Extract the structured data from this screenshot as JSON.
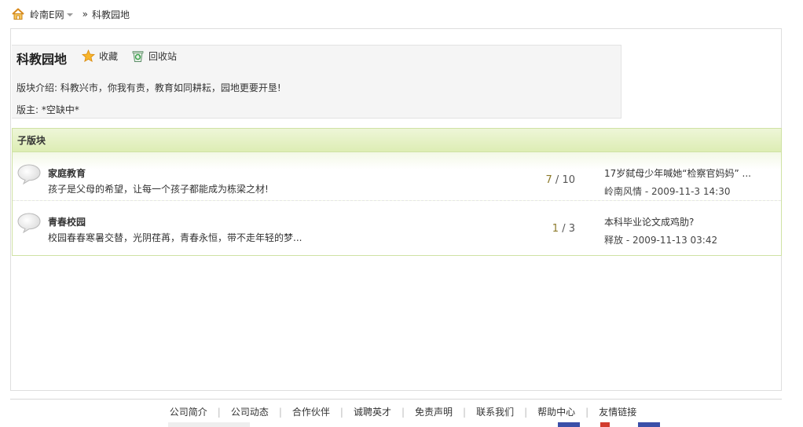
{
  "breadcrumb": {
    "site": "岭南E网",
    "separator": "»",
    "current": "科教园地"
  },
  "forum": {
    "title": "科教园地",
    "favorite_label": "收藏",
    "recycle_label": "回收站",
    "description": "版块介绍: 科教兴市，你我有责，教育如同耕耘，园地更要开垦!",
    "moderators": "版主: *空缺中*"
  },
  "subforums": {
    "header": "子版块",
    "rows": [
      {
        "name": "家庭教育",
        "description": "孩子是父母的希望，让每一个孩子都能成为栋梁之材!",
        "threads": "7",
        "slash": "/",
        "posts": "10",
        "last_title": "17岁弑母少年喊她“检察官妈妈” ...",
        "last_author_time": "岭南风情 - 2009-11-3 14:30"
      },
      {
        "name": "青春校园",
        "description": "校园春春寒暑交替，光阴荏苒，青春永恒，带不走年轻的梦...",
        "threads": "1",
        "slash": "/",
        "posts": "3",
        "last_title": "本科毕业论文成鸡肋?",
        "last_author_time": "释放 - 2009-11-13 03:42"
      }
    ]
  },
  "footer": {
    "links": [
      "公司简介",
      "公司动态",
      "合作伙伴",
      "诚聘英才",
      "免责声明",
      "联系我们",
      "帮助中心",
      "友情链接"
    ],
    "separator": "|"
  },
  "colors": {
    "header_green": "#ddedb4",
    "header_border": "#cfe2a4",
    "thread_count": "#8c7a2a"
  },
  "icons": {
    "home": "home-icon",
    "favorite": "star-icon",
    "recycle": "recycle-icon",
    "forum_status": "speech-bubble-icon"
  }
}
